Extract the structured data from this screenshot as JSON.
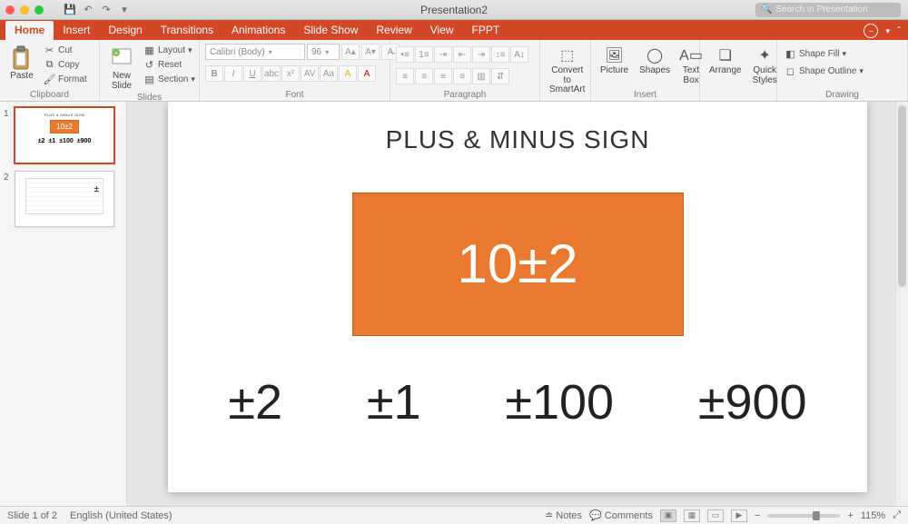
{
  "window": {
    "title": "Presentation2"
  },
  "search": {
    "placeholder": "Search in Presentation"
  },
  "tabs": [
    "Home",
    "Insert",
    "Design",
    "Transitions",
    "Animations",
    "Slide Show",
    "Review",
    "View",
    "FPPT"
  ],
  "active_tab": "Home",
  "ribbon": {
    "clipboard": {
      "paste": "Paste",
      "cut": "Cut",
      "copy": "Copy",
      "format": "Format",
      "label": "Clipboard"
    },
    "slides": {
      "new_slide": "New\nSlide",
      "layout": "Layout",
      "reset": "Reset",
      "section": "Section",
      "label": "Slides"
    },
    "font": {
      "name": "Calibri (Body)",
      "size": "96",
      "label": "Font"
    },
    "paragraph": {
      "label": "Paragraph"
    },
    "smartart": {
      "convert": "Convert to\nSmartArt"
    },
    "insert": {
      "picture": "Picture",
      "shapes": "Shapes",
      "textbox": "Text\nBox",
      "label": "Insert"
    },
    "arrange": {
      "arrange": "Arrange",
      "quick": "Quick\nStyles"
    },
    "drawing": {
      "fill": "Shape Fill",
      "outline": "Shape Outline",
      "label": "Drawing"
    }
  },
  "thumbs": {
    "n1": "1",
    "n2": "2",
    "t1_title": "PLUS & MINUS SIGN",
    "t1_box": "10±2",
    "t1_row": [
      "±2",
      "±1",
      "±100",
      "±900"
    ],
    "t2_pm": "±"
  },
  "slide": {
    "title": "PLUS & MINUS SIGN",
    "box": "10±2",
    "row": [
      "±2",
      "±1",
      "±100",
      "±900"
    ]
  },
  "status": {
    "page": "Slide 1 of 2",
    "lang": "English (United States)",
    "notes": "Notes",
    "comments": "Comments",
    "zoom": "115%"
  },
  "colors": {
    "accent": "#d24726",
    "orange": "#e8792f"
  }
}
